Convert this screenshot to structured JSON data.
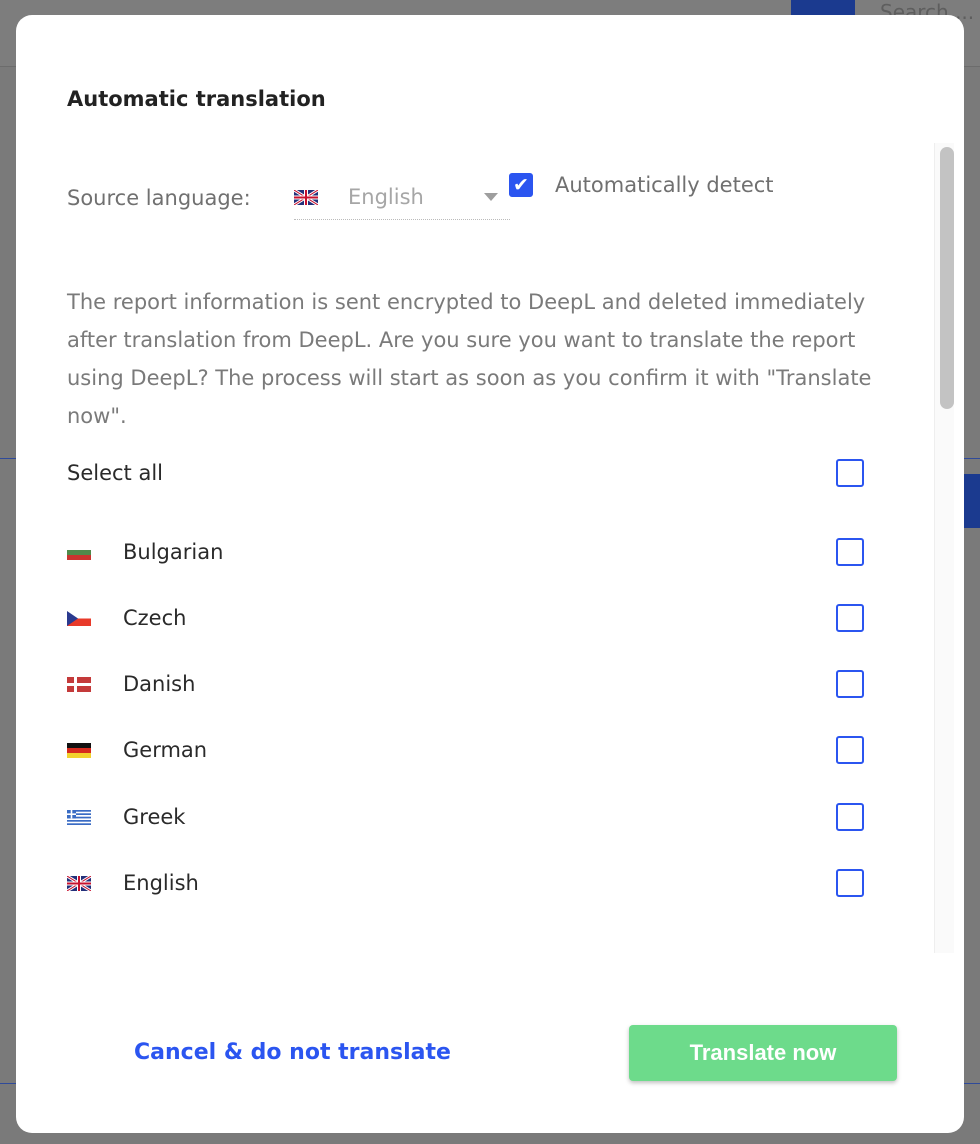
{
  "background": {
    "search_placeholder": "Search ..."
  },
  "modal": {
    "title": "Automatic translation",
    "source_language_label": "Source language:",
    "source_language_value": "English",
    "source_language_flag": "uk-flag-icon",
    "auto_detect_label": "Automatically detect",
    "auto_detect_checked": true,
    "description": "The report information is sent encrypted to DeepL and deleted immediately after translation from DeepL. Are you sure you want to translate the report using DeepL? The process will start as soon as you confirm it with \"Translate now\".",
    "select_all_label": "Select all",
    "languages": [
      {
        "label": "Bulgarian",
        "flag": "bulgaria-flag-icon",
        "checked": false
      },
      {
        "label": "Czech",
        "flag": "czech-flag-icon",
        "checked": false
      },
      {
        "label": "Danish",
        "flag": "denmark-flag-icon",
        "checked": false
      },
      {
        "label": "German",
        "flag": "germany-flag-icon",
        "checked": false
      },
      {
        "label": "Greek",
        "flag": "greece-flag-icon",
        "checked": false
      },
      {
        "label": "English",
        "flag": "uk-flag-icon",
        "checked": false
      }
    ],
    "cancel_label": "Cancel & do not translate",
    "confirm_label": "Translate now"
  },
  "colors": {
    "accent": "#2b55f0",
    "confirm": "#6ddb8b"
  }
}
